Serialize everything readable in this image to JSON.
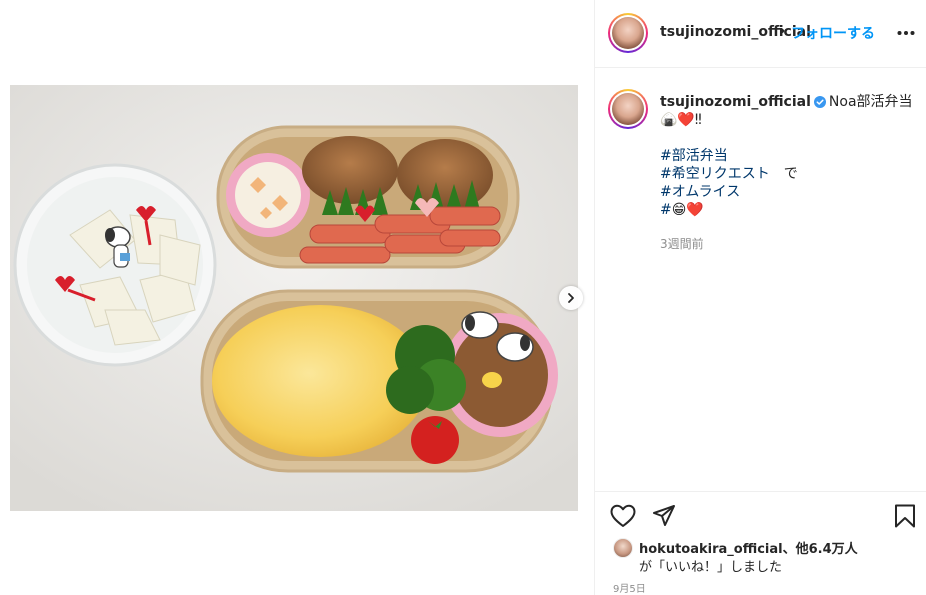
{
  "post": {
    "username": "tsujinozomi_official",
    "separator": "•",
    "follow_label": "フォローする",
    "more_icon": "more-horizontal-icon"
  },
  "caption": {
    "username": "tsujinozomi_official",
    "text": "Noa部活弁当",
    "emoji_line": "🍙❤️‼",
    "hashtag1": "#部活弁当",
    "hashtag2": "#希空リクエスト",
    "hashtag2_suffix": "　で",
    "hashtag3": "#オムライス",
    "hashtag4": "#",
    "hashtag4_emoji": "😁❤️",
    "time_ago": "3週間前"
  },
  "actions": {
    "like_icon": "heart-icon",
    "share_icon": "paper-plane-icon",
    "save_icon": "bookmark-icon"
  },
  "likes": {
    "liker": "hokutoakira_official",
    "others": "、他6.4万人",
    "suffix": "が「いいね！」しました"
  },
  "date": "9月5日",
  "colors": {
    "link": "#0095f6",
    "hashtag": "#00376b",
    "muted": "#8e8e8e"
  }
}
